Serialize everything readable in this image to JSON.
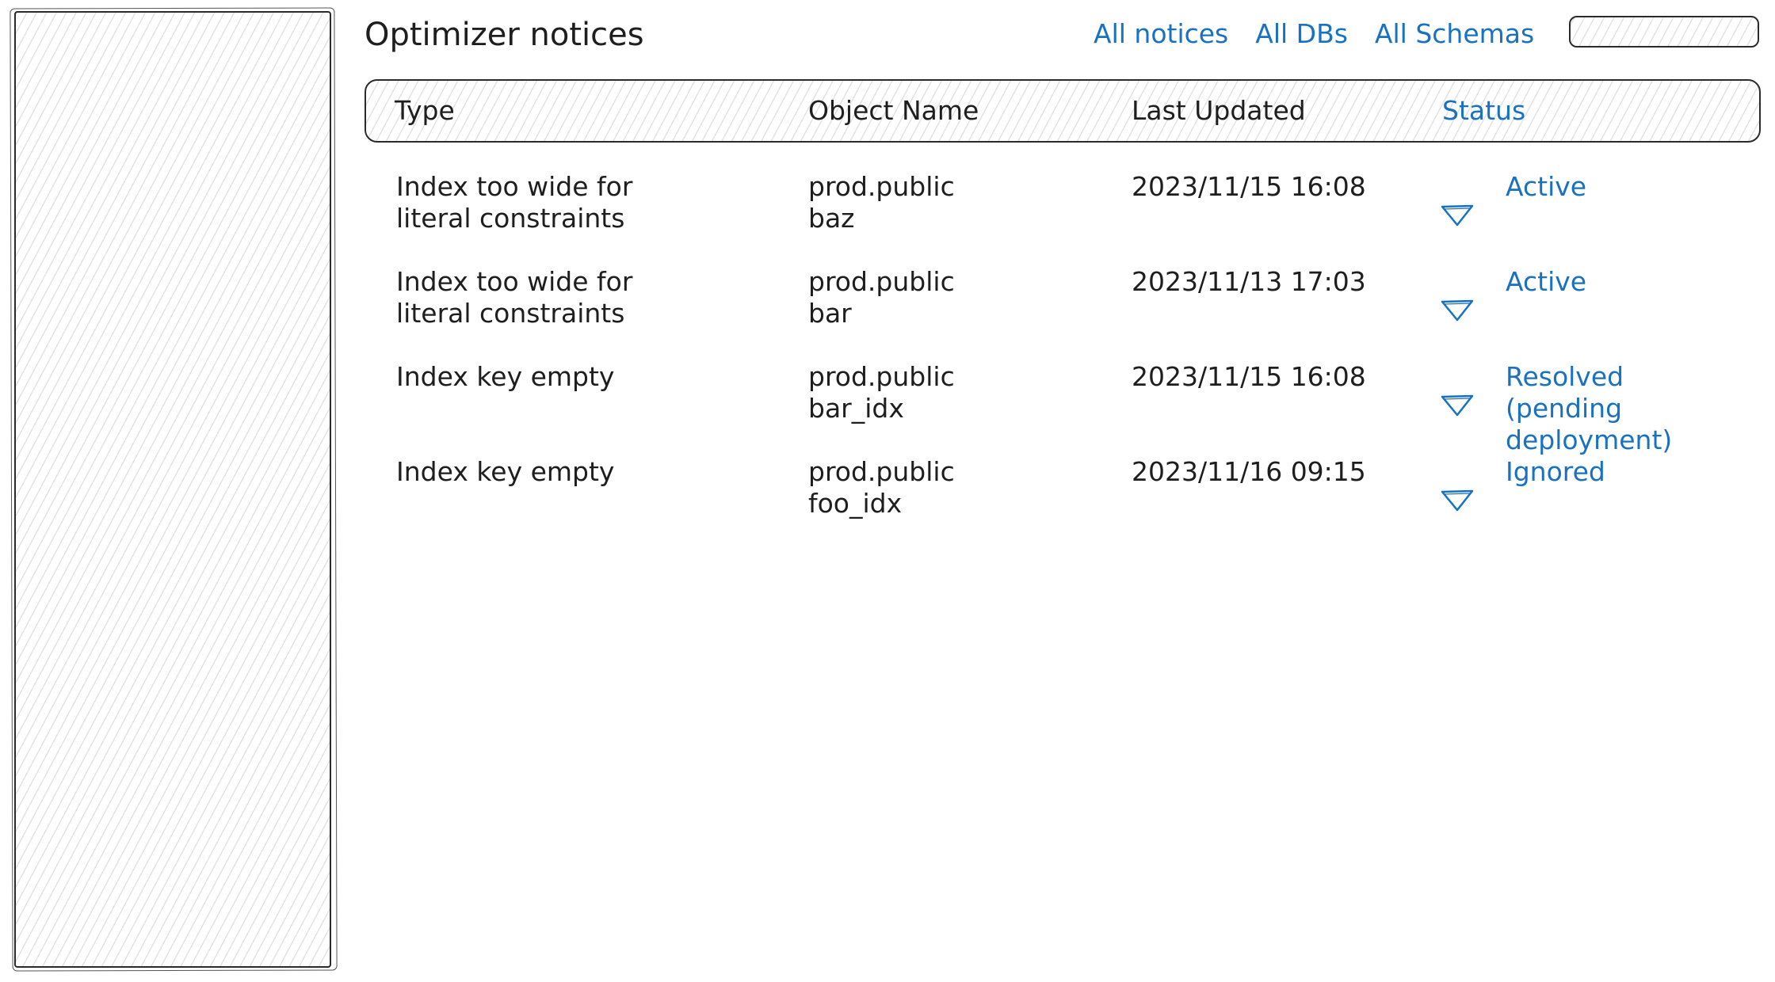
{
  "header": {
    "title": "Optimizer notices",
    "filters": [
      "All notices",
      "All DBs",
      "All Schemas"
    ],
    "search_value": ""
  },
  "table": {
    "columns": [
      "Type",
      "Object Name",
      "Last Updated",
      "Status"
    ],
    "rows": [
      {
        "type": "Index too wide for\nliteral constraints",
        "object": "prod.public\nbaz",
        "updated": "2023/11/15 16:08",
        "status_icon": "triangle-down-icon",
        "status": "Active"
      },
      {
        "type": "Index too wide for\nliteral constraints",
        "object": "prod.public\nbar",
        "updated": "2023/11/13 17:03",
        "status_icon": "triangle-down-icon",
        "status": "Active"
      },
      {
        "type": "Index key empty",
        "object": "prod.public\nbar_idx",
        "updated": "2023/11/15 16:08",
        "status_icon": "triangle-down-icon",
        "status": "Resolved\n(pending deployment)"
      },
      {
        "type": "Index key empty",
        "object": "prod.public\nfoo_idx",
        "updated": "2023/11/16 09:15",
        "status_icon": "triangle-down-icon",
        "status": "Ignored"
      }
    ]
  },
  "colors": {
    "accent": "#1971c2",
    "ink": "#1e1e1e",
    "hatch": "#787878"
  }
}
